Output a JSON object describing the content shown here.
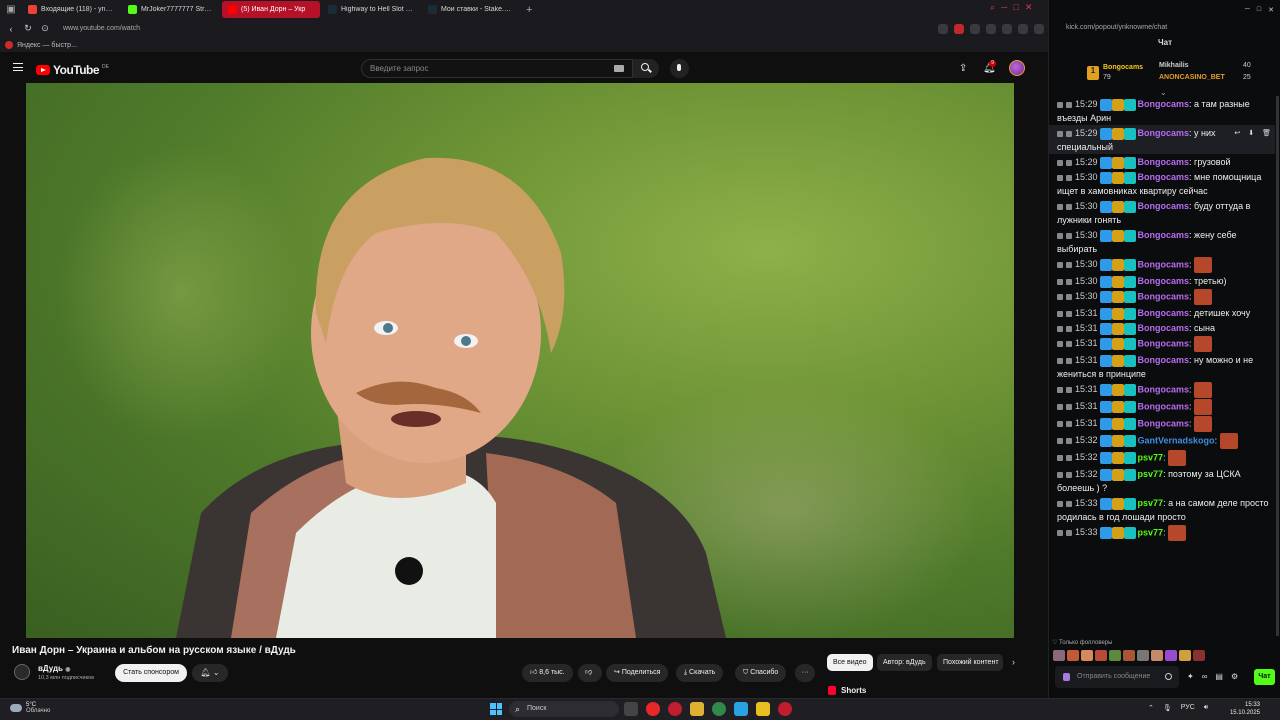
{
  "browser": {
    "tabs": [
      {
        "label": "Входящие (118) - ynknow",
        "color": "#ea4335",
        "active": false
      },
      {
        "label": "MrJoker7777777 Stream",
        "color": "#53fc18",
        "active": false
      },
      {
        "label": "(5) Иван Дорн – Укр",
        "color": "#ff0000",
        "active": true
      },
      {
        "label": "Highway to Hell Slot Gam",
        "color": "#1a2c38",
        "active": false
      },
      {
        "label": "Мои ставки - Stake.com",
        "color": "#1a2c38",
        "active": false
      }
    ],
    "new_tab": "+",
    "url": "www.youtube.com/watch",
    "bookmark": "Яндекс — быстр..."
  },
  "youtube": {
    "logo": "YouTube",
    "region": "DE",
    "search_placeholder": "Введите запрос",
    "notif_count": "9",
    "video_title": "Иван Дорн – Украина и альбом на русском языке / вДудь",
    "channel": "вДудь",
    "verified": "◉",
    "subscribers": "10,3 млн подписчиков",
    "sponsor": "Стать спонсором",
    "likes": "8,6 тыс.",
    "share": "Поделиться",
    "download": "Скачать",
    "thanks": "Спасибо",
    "more": "···",
    "chips": [
      "Все видео",
      "Автор: вДудь",
      "Похожий контент"
    ],
    "shorts": "Shorts"
  },
  "chat": {
    "url": "kick.com/popout/ynknowme/chat",
    "header": "Чат",
    "leaderboard": [
      {
        "name": "Bongocams",
        "value": "79",
        "color": "#f3c623"
      },
      {
        "name": "Mikhailis",
        "value": "40",
        "color": "#cfcfcf"
      },
      {
        "name": "ANONCASINO_BET",
        "value": "25",
        "color": "#e59b2a"
      }
    ],
    "messages": [
      {
        "time": "15:29",
        "user": "Bongocams",
        "color": "#b86cf0",
        "text": ": а там разные въезды Арин",
        "emote": false
      },
      {
        "time": "15:29",
        "user": "Bongocams",
        "color": "#b86cf0",
        "text": ": у них специальный",
        "emote": false,
        "hl": true
      },
      {
        "time": "15:29",
        "user": "Bongocams",
        "color": "#b86cf0",
        "text": ": грузовой",
        "emote": false
      },
      {
        "time": "15:30",
        "user": "Bongocams",
        "color": "#b86cf0",
        "text": ": мне помощница ищет в хамовниках квартиру сейчас",
        "emote": false
      },
      {
        "time": "15:30",
        "user": "Bongocams",
        "color": "#b86cf0",
        "text": ": буду оттуда в лужники гонять",
        "emote": false
      },
      {
        "time": "15:30",
        "user": "Bongocams",
        "color": "#b86cf0",
        "text": ": жену себе выбирать",
        "emote": false
      },
      {
        "time": "15:30",
        "user": "Bongocams",
        "color": "#b86cf0",
        "text": ":",
        "emote": true
      },
      {
        "time": "15:30",
        "user": "Bongocams",
        "color": "#b86cf0",
        "text": ": третью)",
        "emote": false
      },
      {
        "time": "15:30",
        "user": "Bongocams",
        "color": "#b86cf0",
        "text": ":",
        "emote": true
      },
      {
        "time": "15:31",
        "user": "Bongocams",
        "color": "#b86cf0",
        "text": ": детишек хочу",
        "emote": false
      },
      {
        "time": "15:31",
        "user": "Bongocams",
        "color": "#b86cf0",
        "text": ": сына",
        "emote": false
      },
      {
        "time": "15:31",
        "user": "Bongocams",
        "color": "#b86cf0",
        "text": ":",
        "emote": true
      },
      {
        "time": "15:31",
        "user": "Bongocams",
        "color": "#b86cf0",
        "text": ": ну можно и не жениться в принципе",
        "emote": false
      },
      {
        "time": "15:31",
        "user": "Bongocams",
        "color": "#b86cf0",
        "text": ":",
        "emote": true
      },
      {
        "time": "15:31",
        "user": "Bongocams",
        "color": "#b86cf0",
        "text": ":",
        "emote": true
      },
      {
        "time": "15:31",
        "user": "Bongocams",
        "color": "#b86cf0",
        "text": ":",
        "emote": true
      },
      {
        "time": "15:32",
        "user": "GantVernadskogo",
        "color": "#3f8de0",
        "text": ":",
        "emote": true
      },
      {
        "time": "15:32",
        "user": "psv77",
        "color": "#53fc18",
        "text": ":",
        "emote": true
      },
      {
        "time": "15:32",
        "user": "psv77",
        "color": "#53fc18",
        "text": ": поэтому за ЦСКА болеешь ) ?",
        "emote": false
      },
      {
        "time": "15:33",
        "user": "psv77",
        "color": "#53fc18",
        "text": ": а на самом деле просто родилась в год лошади просто",
        "emote": false
      },
      {
        "time": "15:33",
        "user": "psv77",
        "color": "#53fc18",
        "text": ":",
        "emote": true
      }
    ],
    "followers_only": "Только фолловеры",
    "input_placeholder": "Отправить сообщение",
    "send": "Чат"
  },
  "taskbar": {
    "temp": "5°C",
    "weather": "Облачно",
    "search": "Поиск",
    "lang": "РУС",
    "time": "15:33",
    "date": "15.10.2025"
  }
}
